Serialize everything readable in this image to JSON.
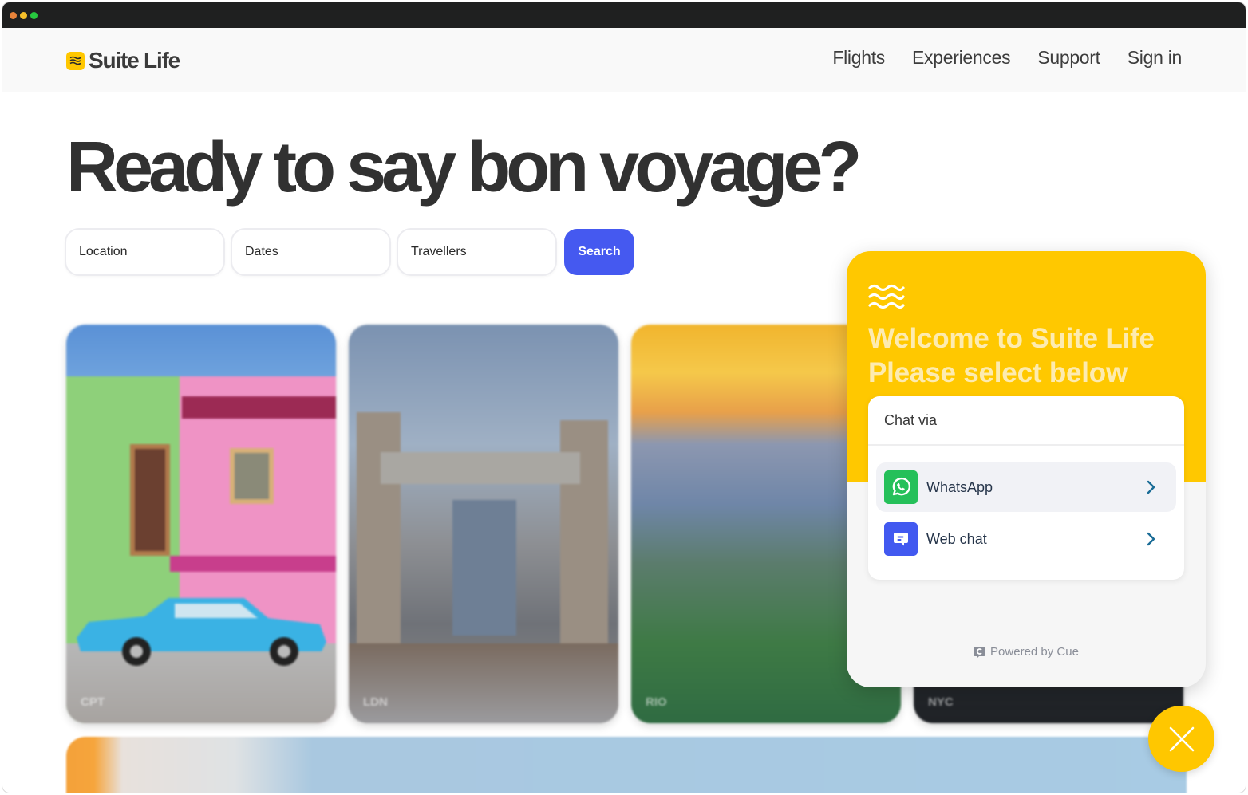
{
  "window": {
    "controls": [
      "close",
      "minimize",
      "maximize"
    ]
  },
  "brand": {
    "name": "Suite Life",
    "logo_icon": "waves-icon",
    "accent_color": "#ffc700"
  },
  "nav": {
    "links": [
      {
        "label": "Flights"
      },
      {
        "label": "Experiences"
      },
      {
        "label": "Support"
      },
      {
        "label": "Sign in"
      }
    ]
  },
  "hero": {
    "title": "Ready to say bon voyage?"
  },
  "search": {
    "location_placeholder": "Location",
    "dates_placeholder": "Dates",
    "travellers_placeholder": "Travellers",
    "button_label": "Search",
    "button_color": "#4559f0"
  },
  "destinations": [
    {
      "code": "CPT"
    },
    {
      "code": "LDN"
    },
    {
      "code": "RIO"
    },
    {
      "code": "NYC"
    }
  ],
  "chat_widget": {
    "header_icon": "waves-icon",
    "title_line1": "Welcome to Suite Life",
    "title_line2": "Please select below",
    "section_label": "Chat via",
    "options": [
      {
        "label": "WhatsApp",
        "icon": "whatsapp-icon"
      },
      {
        "label": "Web chat",
        "icon": "web-chat-icon"
      }
    ],
    "powered_by": "Powered by Cue",
    "header_color": "#ffc800"
  },
  "close_button": {
    "icon": "close-icon"
  }
}
